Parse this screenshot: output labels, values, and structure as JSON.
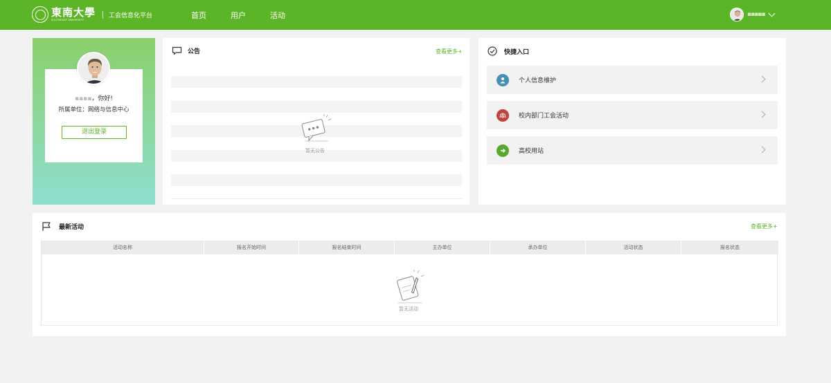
{
  "header": {
    "logo_cn": "東南大學",
    "logo_en": "SOUTHEAST UNIVERSITY",
    "subtitle": "工会信息化平台",
    "nav": [
      "首页",
      "用户",
      "活动"
    ],
    "user_name": "▪▪▪▪▪"
  },
  "profile": {
    "name_masked": "▪▪▪▪",
    "greeting": "，你好!",
    "org": "所属单位：网络与信息中心",
    "logout": "退出登录"
  },
  "notice": {
    "title": "公告",
    "more": "查看更多+",
    "empty_text": "暂无公告"
  },
  "quick": {
    "title": "快捷入口",
    "items": [
      {
        "label": "个人信息维护",
        "color": "#4591b6",
        "icon": "person-icon"
      },
      {
        "label": "校内部门工会活动",
        "color": "#c0433f",
        "icon": "union-icon"
      },
      {
        "label": "高校用站",
        "color": "#5aa82b",
        "icon": "arrow-right-icon"
      }
    ]
  },
  "activities": {
    "title": "最新活动",
    "more": "查看更多+",
    "columns": [
      "活动名称",
      "报名开始时间",
      "报名结束时间",
      "主办单位",
      "承办单位",
      "活动状态",
      "报名状态"
    ],
    "empty_text": "暂无活动"
  },
  "colors": {
    "brand_green": "#5cb526",
    "page_bg": "#f2f2f2"
  }
}
